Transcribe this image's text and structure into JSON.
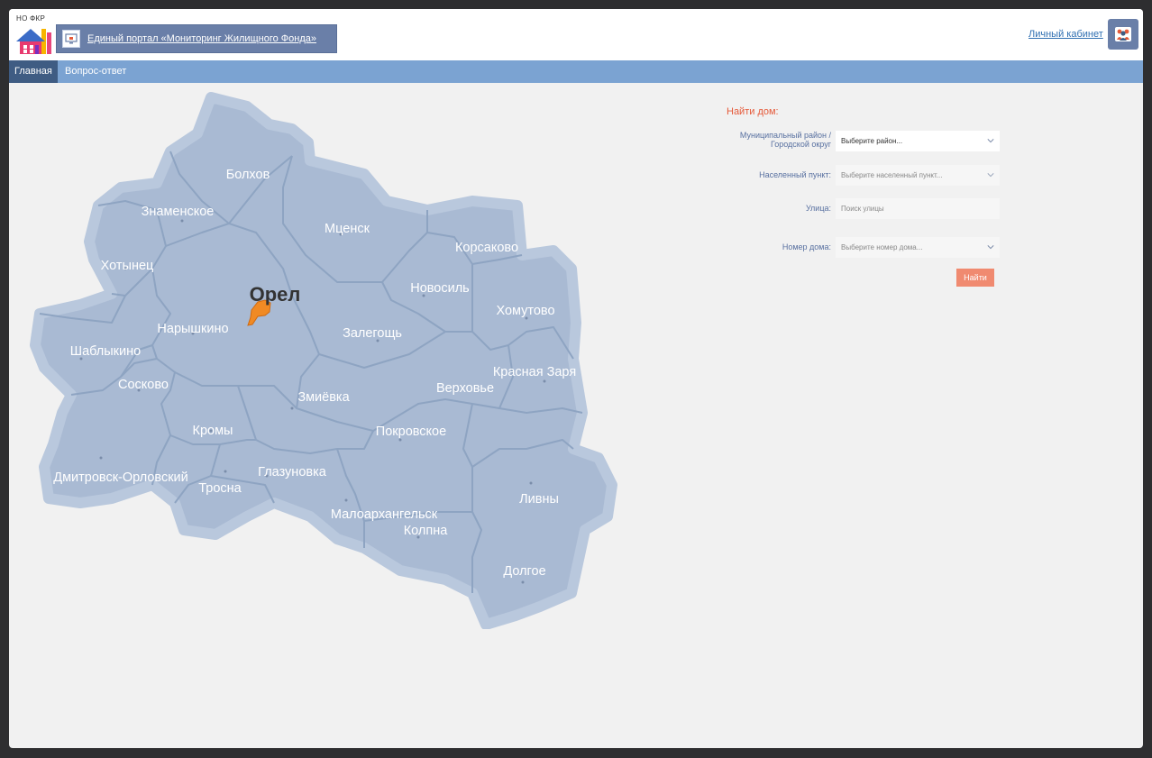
{
  "header": {
    "org_label": "НО ФКР",
    "portal_title": "Единый портал «Мониторинг Жилищного Фонда»",
    "cabinet_label": "Личный кабинет"
  },
  "nav": [
    {
      "label": "Главная",
      "active": true
    },
    {
      "label": "Вопрос-ответ",
      "active": false
    }
  ],
  "map": {
    "capital_label": "Орел",
    "districts": [
      "Болхов",
      "Знаменское",
      "Мценск",
      "Корсаково",
      "Хотынец",
      "Новосиль",
      "Хомутово",
      "Нарышкино",
      "Залегощь",
      "Шаблыкино",
      "Сосково",
      "Красная Заря",
      "Верховье",
      "Змиёвка",
      "Кромы",
      "Покровское",
      "Дмитровск-Орловский",
      "Глазуновка",
      "Тросна",
      "Ливны",
      "Малоархангельск",
      "Колпна",
      "Долгое"
    ],
    "capital_color": "#f08a24"
  },
  "search": {
    "title": "Найти дом:",
    "district_label": "Муниципальный район / Городской округ",
    "district_value": "Выберите район...",
    "locality_label": "Населенный пункт:",
    "locality_placeholder": "Выберите населенный пункт...",
    "street_label": "Улица:",
    "street_placeholder": "Поиск улицы",
    "house_label": "Номер дома:",
    "house_placeholder": "Выберите номер дома...",
    "find_button": "Найти"
  },
  "colors": {
    "accent": "#6a7fa8",
    "nav_bar": "#7ba3d2",
    "nav_active": "#3f5c83",
    "district_fill": "#a9bad3",
    "search_title": "#e55a3a",
    "find_button": "#f08a70"
  },
  "icons": {
    "logo": "house-logo-icon",
    "portal": "monitor-icon",
    "cabinet": "users-icon",
    "dropdown": "chevron-down-icon"
  }
}
